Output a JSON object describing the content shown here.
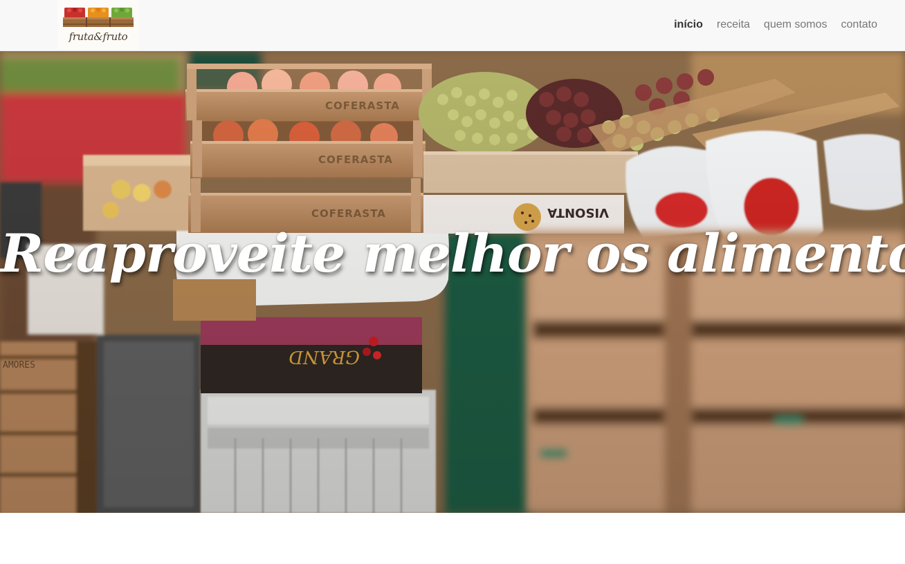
{
  "brand": {
    "name": "fruta&fruto",
    "logo_icon": "fruit-crates-logo-icon"
  },
  "nav": {
    "items": [
      {
        "label": "início",
        "active": true
      },
      {
        "label": "receita",
        "active": false
      },
      {
        "label": "quem somos",
        "active": false
      },
      {
        "label": "contato",
        "active": false
      }
    ]
  },
  "hero": {
    "title": "Reaproveite melhor os alimentos!",
    "image_subject": "market-produce-crates-photo",
    "crate_labels": [
      "COFERASTA",
      "COFERASTA",
      "COFERASTA",
      "VISONTA",
      "GRAND",
      "AMORES"
    ]
  },
  "colors": {
    "navbar_bg": "#f8f8f8",
    "nav_text": "#777777",
    "nav_active": "#333333",
    "hero_title": "#ffffff"
  }
}
